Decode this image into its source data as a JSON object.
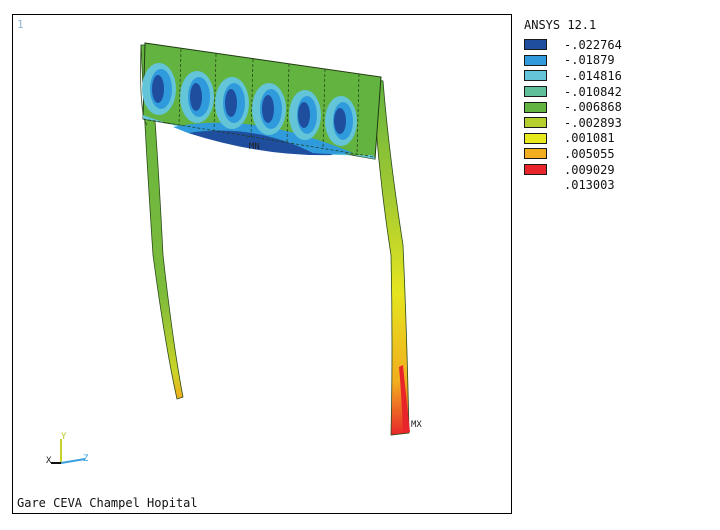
{
  "viewport": {
    "number": "1",
    "footer_title": "Gare CEVA Champel Hopital"
  },
  "labels": {
    "min": "MN",
    "max": "MX"
  },
  "triad": {
    "x": "X",
    "y": "Y",
    "z": "Z"
  },
  "legend": {
    "title": "ANSYS 12.1",
    "items": [
      {
        "value": "-.022764",
        "color": "#1f4e9e"
      },
      {
        "value": "-.01879",
        "color": "#2f9bdc"
      },
      {
        "value": "-.014816",
        "color": "#64c4d8"
      },
      {
        "value": "-.010842",
        "color": "#5fbf9a"
      },
      {
        "value": "-.006868",
        "color": "#63b340"
      },
      {
        "value": "-.002893",
        "color": "#b6cf2c"
      },
      {
        "value": ".001081",
        "color": "#e8e81e"
      },
      {
        "value": ".005055",
        "color": "#f2ae1e"
      },
      {
        "value": ".009029",
        "color": "#e8252a"
      },
      {
        "value": ".013003",
        "color": ""
      }
    ]
  }
}
